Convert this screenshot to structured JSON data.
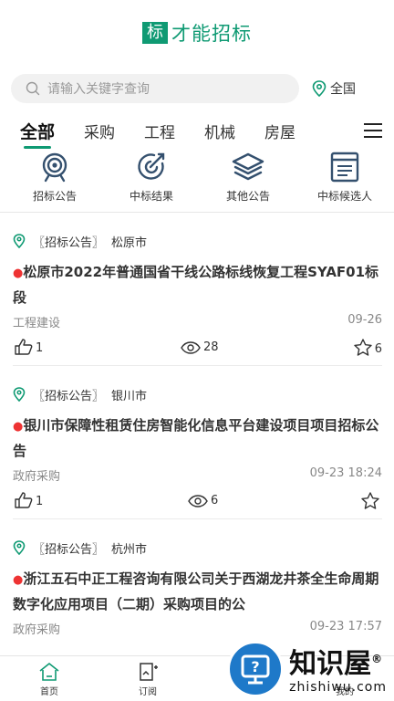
{
  "brand": {
    "mark": "标",
    "name": "才能招标",
    "color": "#0f9a73"
  },
  "search": {
    "placeholder": "请输入关键字查询",
    "icon": "search-icon"
  },
  "region": {
    "label": "全国",
    "icon": "location-pin-icon"
  },
  "tabs": [
    {
      "label": "全部",
      "active": true
    },
    {
      "label": "采购"
    },
    {
      "label": "工程"
    },
    {
      "label": "机械"
    },
    {
      "label": "房屋"
    }
  ],
  "categories": [
    {
      "label": "招标公告",
      "icon": "target-icon"
    },
    {
      "label": "中标结果",
      "icon": "hit-target-icon"
    },
    {
      "label": "其他公告",
      "icon": "layers-icon"
    },
    {
      "label": "中标候选人",
      "icon": "document-icon"
    }
  ],
  "cards": [
    {
      "tag": "〖招标公告〗",
      "city": "松原市",
      "title": "松原市2022年普通国省干线公路标线恢复工程SYAF01标段",
      "category": "工程建设",
      "date": "09-26",
      "likes": "1",
      "views": "28",
      "stars": "6"
    },
    {
      "tag": "〖招标公告〗",
      "city": "银川市",
      "title": "银川市保障性租赁住房智能化信息平台建设项目项目招标公告",
      "category": "政府采购",
      "date": "09-23 18:24",
      "likes": "1",
      "views": "6",
      "stars": ""
    },
    {
      "tag": "〖招标公告〗",
      "city": "杭州市",
      "title": "浙江五石中正工程咨询有限公司关于西湖龙井茶全生命周期数字化应用项目（二期）采购项目的公",
      "category": "政府采购",
      "date": "09-23 17:57",
      "likes": "",
      "views": "",
      "stars": ""
    }
  ],
  "bottom_nav": [
    {
      "label": "首页",
      "icon": "home-icon"
    },
    {
      "label": "订阅",
      "icon": "subscribe-icon"
    },
    {
      "label": "",
      "icon": ""
    },
    {
      "label": "我的",
      "icon": "profile-icon"
    }
  ],
  "watermark": {
    "name": "知识屋",
    "site": "zhishiwu.com",
    "registered": "®"
  }
}
